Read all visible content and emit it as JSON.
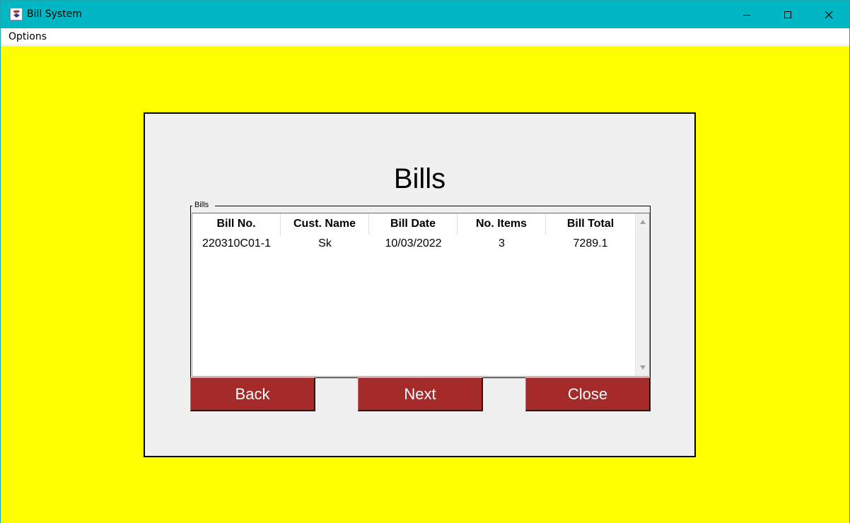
{
  "window": {
    "title": "Bill System"
  },
  "menu": {
    "items": [
      {
        "label": "Options"
      }
    ]
  },
  "page": {
    "heading": "Bills"
  },
  "bills_group": {
    "label": "Bills",
    "columns": [
      "Bill No.",
      "Cust. Name",
      "Bill Date",
      "No. Items",
      "Bill Total"
    ],
    "rows": [
      [
        "220310C01-1",
        "Sk",
        "10/03/2022",
        "3",
        "7289.1"
      ]
    ]
  },
  "buttons": {
    "back": "Back",
    "next": "Next",
    "close": "Close"
  },
  "colors": {
    "titlebar": "#00b7c3",
    "background": "#ffff00",
    "panel": "#f0f0f0",
    "button": "#a52a2a",
    "button_text": "#ffffff"
  }
}
